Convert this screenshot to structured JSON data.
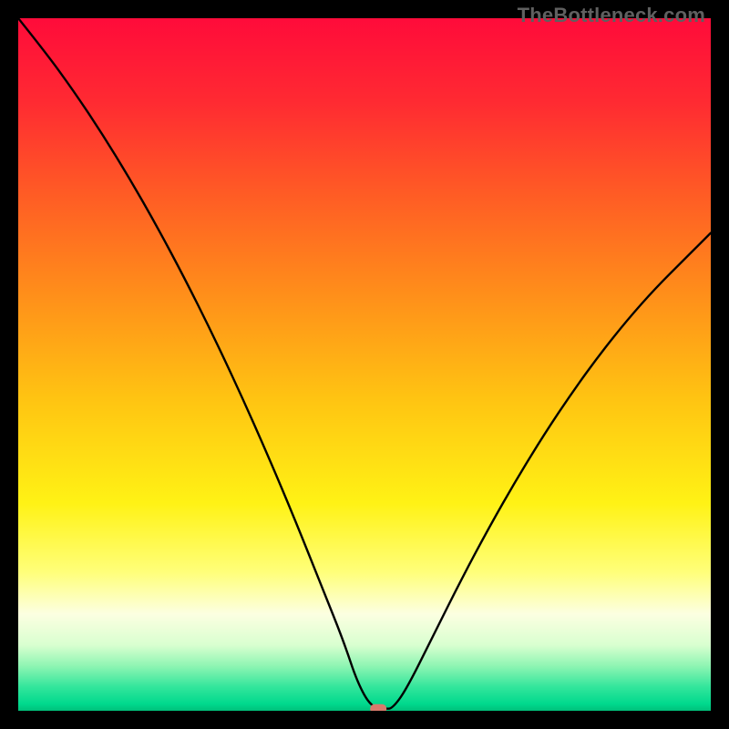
{
  "watermark": "TheBottleneck.com",
  "chart_data": {
    "type": "line",
    "title": "",
    "xlabel": "",
    "ylabel": "",
    "xlim": [
      0,
      100
    ],
    "ylim": [
      0,
      100
    ],
    "grid": false,
    "legend": false,
    "background": {
      "kind": "vertical-gradient",
      "stops": [
        {
          "pos": 0.0,
          "color": "#ff0b3a"
        },
        {
          "pos": 0.12,
          "color": "#ff2a32"
        },
        {
          "pos": 0.25,
          "color": "#ff5a25"
        },
        {
          "pos": 0.4,
          "color": "#ff8f1a"
        },
        {
          "pos": 0.55,
          "color": "#ffc412"
        },
        {
          "pos": 0.7,
          "color": "#fff215"
        },
        {
          "pos": 0.8,
          "color": "#ffff7a"
        },
        {
          "pos": 0.86,
          "color": "#fcffe1"
        },
        {
          "pos": 0.905,
          "color": "#d9ffd0"
        },
        {
          "pos": 0.935,
          "color": "#8ff5b3"
        },
        {
          "pos": 0.965,
          "color": "#34e69c"
        },
        {
          "pos": 0.99,
          "color": "#00d98d"
        },
        {
          "pos": 1.0,
          "color": "#00c07a"
        }
      ]
    },
    "series": [
      {
        "name": "bottleneck-curve",
        "color": "#000000",
        "x": [
          0.0,
          4.0,
          8.0,
          12.0,
          16.0,
          20.0,
          24.0,
          28.0,
          32.0,
          36.0,
          40.0,
          44.0,
          47.0,
          49.0,
          51.0,
          53.0,
          54.0,
          56.0,
          60.0,
          64.0,
          68.0,
          72.0,
          76.0,
          80.0,
          84.0,
          88.0,
          92.0,
          96.0,
          100.0
        ],
        "values": [
          100.0,
          95.0,
          89.5,
          83.5,
          77.0,
          70.0,
          62.5,
          54.5,
          46.0,
          37.0,
          27.5,
          17.5,
          10.0,
          4.0,
          0.5,
          0.3,
          0.3,
          3.0,
          11.0,
          19.0,
          26.5,
          33.5,
          40.0,
          46.0,
          51.5,
          56.5,
          61.0,
          65.0,
          69.0
        ]
      }
    ],
    "marker": {
      "name": "bottleneck-marker",
      "x": 52.0,
      "y": 0.3,
      "color": "#d97a6c",
      "shape": "pill"
    }
  }
}
